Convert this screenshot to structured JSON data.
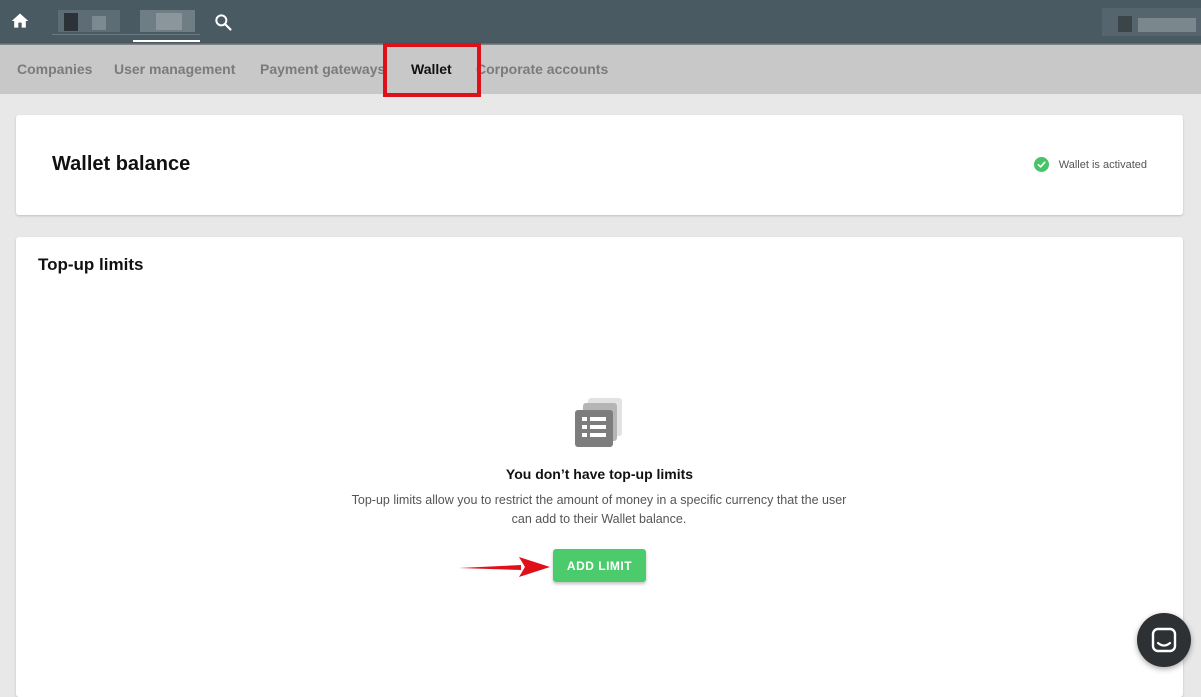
{
  "tabs": [
    {
      "label": "Companies",
      "active": false
    },
    {
      "label": "User management",
      "active": false
    },
    {
      "label": "Payment gateways",
      "active": false
    },
    {
      "label": "Wallet",
      "active": true
    },
    {
      "label": "Corporate accounts",
      "active": false
    }
  ],
  "balance": {
    "title": "Wallet balance",
    "status": "Wallet is activated"
  },
  "limits": {
    "title": "Top-up limits",
    "empty_heading": "You don’t have top-up limits",
    "empty_description": "Top-up limits allow you to restrict the amount of money in a specific currency that the user can add to their Wallet balance.",
    "add_button": "ADD LIMIT"
  },
  "icons": {
    "home": "home-icon",
    "search": "search-icon",
    "status": "check-circle-icon",
    "empty": "list-document-icon",
    "chat": "chat-icon"
  },
  "colors": {
    "topbar": "#4a5a63",
    "accent_green": "#4ccb6c",
    "highlight_red": "#e0101a"
  }
}
